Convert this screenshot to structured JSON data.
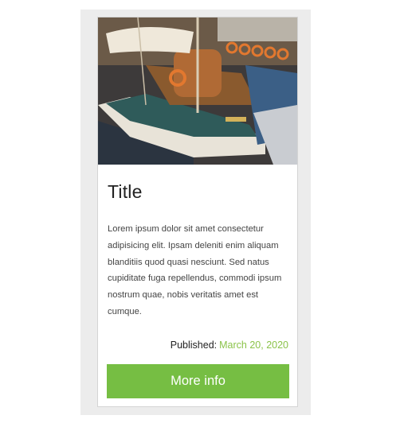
{
  "card": {
    "image_alt": "Moored wooden sailing boat with orange life rings",
    "title": "Title",
    "description": "Lorem ipsum dolor sit amet consectetur adipisicing elit. Ipsam deleniti enim aliquam blanditiis quod quasi nesciunt. Sed natus cupiditate fuga repellendus, commodi ipsum nostrum quae, nobis veritatis amet est cumque.",
    "published_label": "Published:",
    "published_date": "March 20, 2020",
    "button_label": "More info",
    "button_color": "#76be43",
    "date_color": "#8bc34a"
  }
}
